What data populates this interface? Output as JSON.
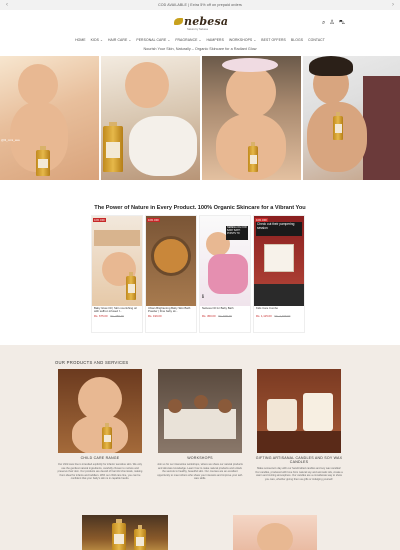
{
  "announcement": {
    "text": "COD AVAILABLE | Extra 5% off on prepaid orders",
    "prev": "‹",
    "next": "›"
  },
  "brand": {
    "name": "nebesa",
    "tagline": "Nature by Nebesa"
  },
  "header_icons": {
    "search": "⌕",
    "account": "♙",
    "cart": "⛍"
  },
  "nav": {
    "items": [
      "HOME",
      "KIDS ⌄",
      "HAIR CARE ⌄",
      "PERSONAL CARE ⌄",
      "FRAGRANCE ⌄",
      "HAMPERS",
      "WORKSHOPS ⌄",
      "BEST OFFERS",
      "BLOGS",
      "CONTACT"
    ]
  },
  "subtagline": "Nourish Your Skin, Naturally – Organic Skincare for a Radiant Glow",
  "hero": {
    "panel1_label": "@lil_mini_asa"
  },
  "mission": "The Power of Nature in Every Product. 100% Organic Skincare for a Vibrant You",
  "products": [
    {
      "badge": "10% OFF",
      "title": "Baby Glow Oil | Skin nourishing oil with saffron infused f...",
      "price": "Rs. 675.00",
      "old_price": "Rs. 750.00"
    },
    {
      "badge": "10% OFF",
      "title": "Ubtan Brightening Baby Skin Bath Powder | Fine baby sk...",
      "price": "Rs. 199.00",
      "old_price": ""
    },
    {
      "badge": "",
      "title": "Nebesa Oil for Baby Bath",
      "price": "Rs. 450.00",
      "old_price": "Rs. 500.00",
      "overlay": "NEBESA OIL FOR BABY BATH POINTS TO"
    },
    {
      "badge": "10% OFF",
      "title": "Kids Care Combo",
      "price": "Rs. 1,115.00",
      "old_price": "Rs. 1,239.00",
      "overlay": "Check out their pampering session"
    }
  ],
  "services": {
    "heading": "OUR PRODUCTS AND SERVICES",
    "items": [
      {
        "title": "CHILD CARE RANGE",
        "desc": "Our child care line is intended explicitly for infants' sensitive skin. We only use the gentlest natural ingredients, carefully chosen to nurture and preserve their skin. Our products are devoid of harmful chemicals, making them ideal for infants and toddlers. With our child care line, you can be confident that your baby's skin is in capable hands."
      },
      {
        "title": "WORKSHOPS",
        "desc": "Join us for our interactive workshops, where we share our natural products and skincare knowledge. Learn how to make natural products and unlock the secrets to healthy, beautiful skin. Our courses are an excellent opportunity to meet others who share your interests and improve your self-care skills."
      },
      {
        "title": "GIFTING ARTISANAL CANDLES AND SOY WAX CANDLES",
        "desc": "Make someone's day with our handcrafted candles and soy wax candles! Our candles, produced with love from natural soy and aromatic oils, create a warm and inviting atmosphere. Our candles are a considerate way to show you care, whether giving them as gifts or indulging yourself."
      }
    ]
  },
  "colors": {
    "accent_red": "#c62828",
    "services_bg": "#f2ece6",
    "brand_gold": "#c8a11e"
  }
}
